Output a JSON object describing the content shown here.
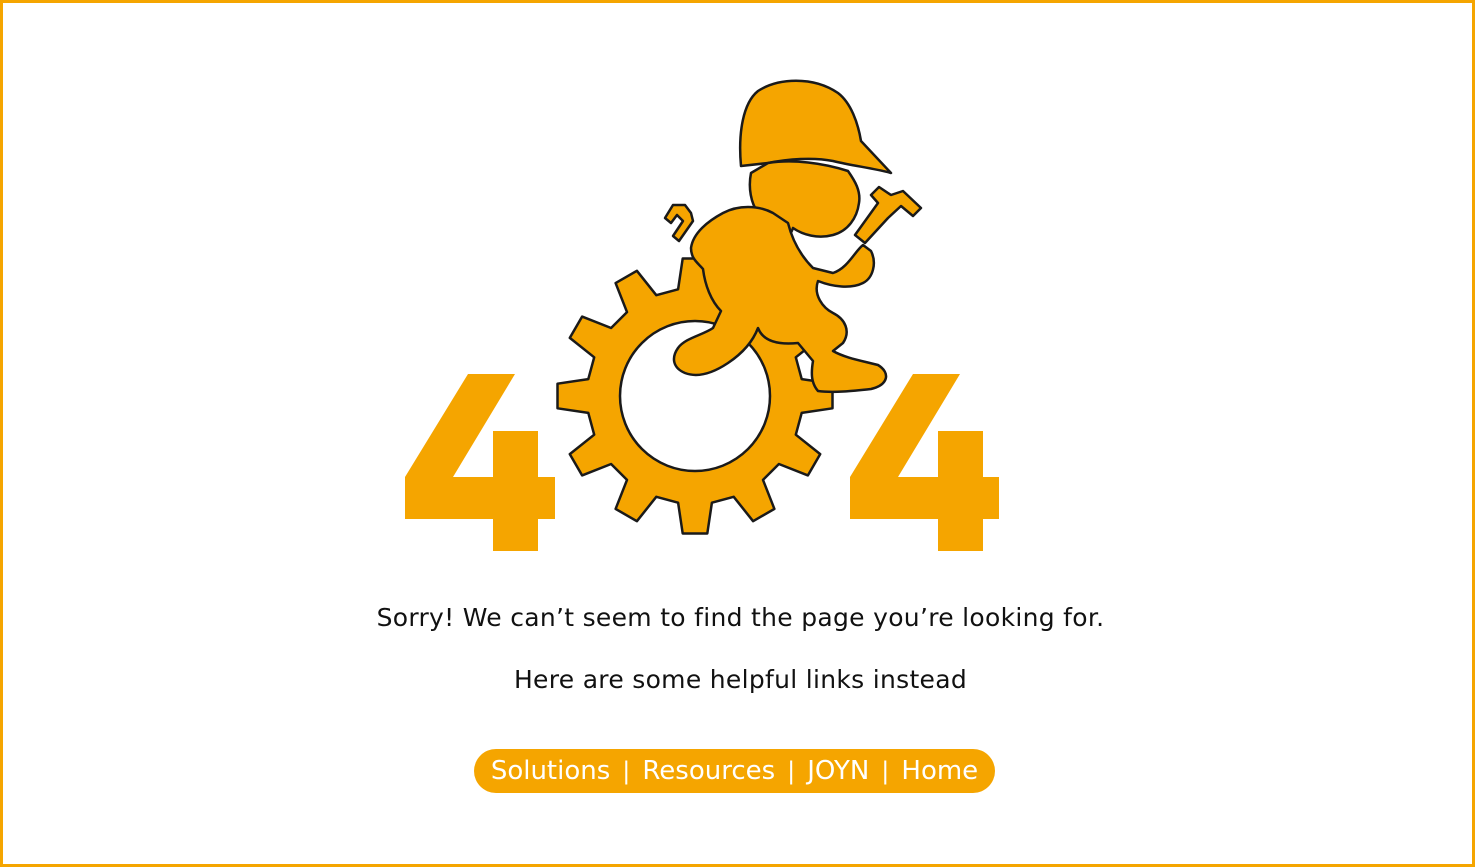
{
  "colors": {
    "accent": "#f5a500",
    "text": "#111111",
    "background": "#ffffff"
  },
  "illustration": {
    "icon": "construction-worker-gear-icon",
    "digit_left": "4",
    "digit_right": "4"
  },
  "message": {
    "sorry": "Sorry! We can’t seem to find the page you’re looking for.",
    "helpful": "Here are some helpful links instead"
  },
  "links": {
    "solutions": "Solutions",
    "resources": "Resources",
    "joyn": "JOYN",
    "home": "Home",
    "separator": "|"
  }
}
